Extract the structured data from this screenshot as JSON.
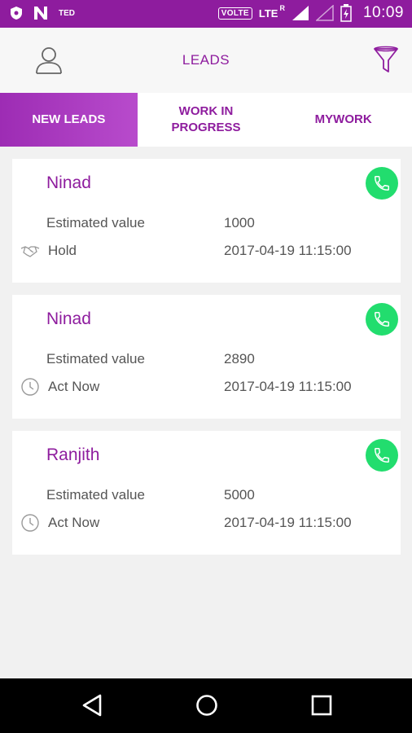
{
  "status_bar": {
    "carrier": "TED",
    "volte": "VOLTE",
    "network": "LTE",
    "roaming": "R",
    "time": "10:09"
  },
  "app_bar": {
    "title": "LEADS",
    "left_icon": "user-icon",
    "right_icon": "filter-icon"
  },
  "tabs": [
    {
      "label": "NEW LEADS",
      "active": true
    },
    {
      "label": "WORK IN PROGRESS",
      "active": false
    },
    {
      "label": "MYWORK",
      "active": false
    }
  ],
  "leads": [
    {
      "name": "Ninad",
      "estimated_label": "Estimated value",
      "estimated_value": "1000",
      "status": "Hold",
      "status_icon": "handshake-icon",
      "date": "2017-04-19 11:15:00"
    },
    {
      "name": "Ninad",
      "estimated_label": "Estimated value",
      "estimated_value": "2890",
      "status": "Act Now",
      "status_icon": "clock-icon",
      "date": "2017-04-19 11:15:00"
    },
    {
      "name": "Ranjith",
      "estimated_label": "Estimated value",
      "estimated_value": "5000",
      "status": "Act Now",
      "status_icon": "clock-icon",
      "date": "2017-04-19 11:15:00"
    }
  ],
  "colors": {
    "primary": "#8e1c9e",
    "call_button": "#22dd6e",
    "background": "#f1f1f1"
  }
}
